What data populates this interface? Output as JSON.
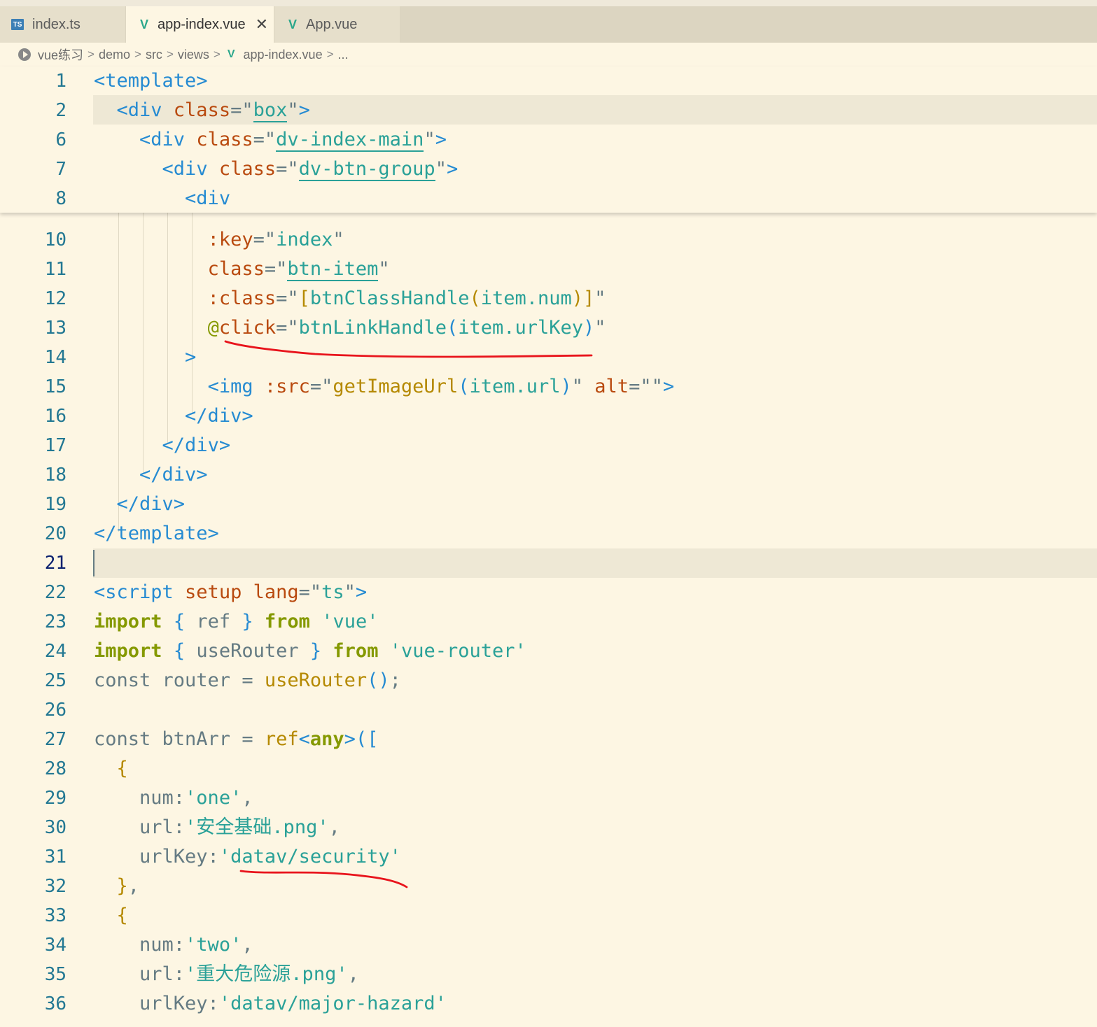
{
  "tabs": [
    {
      "label": "index.ts",
      "icon": "typescript-icon",
      "icon_text": "TS",
      "active": false
    },
    {
      "label": "app-index.vue",
      "icon": "vue-icon",
      "active": true,
      "close": "✕"
    },
    {
      "label": "App.vue",
      "icon": "vue-icon",
      "active": false
    }
  ],
  "breadcrumb": {
    "items": [
      "vue练习",
      "demo",
      "src",
      "views",
      "app-index.vue",
      "..."
    ],
    "separator": ">",
    "vue_glyph": "V"
  },
  "editor": {
    "current_line": "21",
    "sticky_lines": [
      {
        "num": "1",
        "tokens": [
          [
            "t-tag",
            "<template>"
          ]
        ]
      },
      {
        "num": "2",
        "tokens": [
          [
            "t-punc",
            "  "
          ],
          [
            "t-tag",
            "<div "
          ],
          [
            "t-attr",
            "class"
          ],
          [
            "t-punc",
            "=\""
          ],
          [
            "t-cls",
            "box"
          ],
          [
            "t-punc",
            "\""
          ],
          [
            "t-tag",
            ">"
          ]
        ]
      },
      {
        "num": "6",
        "tokens": [
          [
            "t-punc",
            "    "
          ],
          [
            "t-tag",
            "<div "
          ],
          [
            "t-attr",
            "class"
          ],
          [
            "t-punc",
            "=\""
          ],
          [
            "t-cls",
            "dv-index-main"
          ],
          [
            "t-punc",
            "\""
          ],
          [
            "t-tag",
            ">"
          ]
        ]
      },
      {
        "num": "7",
        "tokens": [
          [
            "t-punc",
            "      "
          ],
          [
            "t-tag",
            "<div "
          ],
          [
            "t-attr",
            "class"
          ],
          [
            "t-punc",
            "=\""
          ],
          [
            "t-cls",
            "dv-btn-group"
          ],
          [
            "t-punc",
            "\""
          ],
          [
            "t-tag",
            ">"
          ]
        ]
      },
      {
        "num": "8",
        "tokens": [
          [
            "t-punc",
            "        "
          ],
          [
            "t-tag",
            "<div"
          ]
        ]
      }
    ],
    "lines": [
      {
        "num": "10",
        "tokens": [
          [
            "t-punc",
            "          "
          ],
          [
            "t-attr",
            ":key"
          ],
          [
            "t-punc",
            "=\""
          ],
          [
            "t-str",
            "index"
          ],
          [
            "t-punc",
            "\""
          ]
        ]
      },
      {
        "num": "11",
        "tokens": [
          [
            "t-punc",
            "          "
          ],
          [
            "t-attr",
            "class"
          ],
          [
            "t-punc",
            "=\""
          ],
          [
            "t-cls",
            "btn-item"
          ],
          [
            "t-punc",
            "\""
          ]
        ]
      },
      {
        "num": "12",
        "tokens": [
          [
            "t-punc",
            "          "
          ],
          [
            "t-attr",
            ":class"
          ],
          [
            "t-punc",
            "=\""
          ],
          [
            "t-fn",
            "["
          ],
          [
            "t-str",
            "btnClassHandle"
          ],
          [
            "t-fn",
            "("
          ],
          [
            "t-str",
            "item.num"
          ],
          [
            "t-fn",
            ")]"
          ],
          [
            "t-punc",
            "\""
          ]
        ]
      },
      {
        "num": "13",
        "tokens": [
          [
            "t-punc",
            "          "
          ],
          [
            "t-at",
            "@"
          ],
          [
            "t-attr",
            "click"
          ],
          [
            "t-punc",
            "=\""
          ],
          [
            "t-str",
            "btnLinkHandle"
          ],
          [
            "t-bkt",
            "("
          ],
          [
            "t-str",
            "item.urlKey"
          ],
          [
            "t-bkt",
            ")"
          ],
          [
            "t-punc",
            "\""
          ]
        ]
      },
      {
        "num": "14",
        "tokens": [
          [
            "t-punc",
            "        "
          ],
          [
            "t-tag",
            ">"
          ]
        ]
      },
      {
        "num": "15",
        "tokens": [
          [
            "t-punc",
            "          "
          ],
          [
            "t-tag",
            "<img "
          ],
          [
            "t-attr",
            ":src"
          ],
          [
            "t-punc",
            "=\""
          ],
          [
            "t-fn",
            "getImageUrl"
          ],
          [
            "t-bkt",
            "("
          ],
          [
            "t-str",
            "item.url"
          ],
          [
            "t-bkt",
            ")"
          ],
          [
            "t-punc",
            "\" "
          ],
          [
            "t-attr",
            "alt"
          ],
          [
            "t-punc",
            "=\"\""
          ],
          [
            "t-tag",
            ">"
          ]
        ]
      },
      {
        "num": "16",
        "tokens": [
          [
            "t-punc",
            "        "
          ],
          [
            "t-tag",
            "</div>"
          ]
        ]
      },
      {
        "num": "17",
        "tokens": [
          [
            "t-punc",
            "      "
          ],
          [
            "t-tag",
            "</div>"
          ]
        ]
      },
      {
        "num": "18",
        "tokens": [
          [
            "t-punc",
            "    "
          ],
          [
            "t-tag",
            "</div>"
          ]
        ]
      },
      {
        "num": "19",
        "tokens": [
          [
            "t-punc",
            "  "
          ],
          [
            "t-tag",
            "</div>"
          ]
        ]
      },
      {
        "num": "20",
        "tokens": [
          [
            "t-tag",
            "</template>"
          ]
        ]
      },
      {
        "num": "21",
        "tokens": []
      },
      {
        "num": "22",
        "tokens": [
          [
            "t-tag",
            "<script "
          ],
          [
            "t-attr",
            "setup "
          ],
          [
            "t-attr",
            "lang"
          ],
          [
            "t-punc",
            "=\""
          ],
          [
            "t-str",
            "ts"
          ],
          [
            "t-punc",
            "\""
          ],
          [
            "t-tag",
            ">"
          ]
        ]
      },
      {
        "num": "23",
        "tokens": [
          [
            "t-kw",
            "import"
          ],
          [
            "t-punc",
            " "
          ],
          [
            "t-bkt",
            "{"
          ],
          [
            "t-punc",
            " ref "
          ],
          [
            "t-bkt",
            "}"
          ],
          [
            "t-punc",
            " "
          ],
          [
            "t-kw",
            "from"
          ],
          [
            "t-punc",
            " "
          ],
          [
            "t-str",
            "'vue'"
          ]
        ]
      },
      {
        "num": "24",
        "tokens": [
          [
            "t-kw",
            "import"
          ],
          [
            "t-punc",
            " "
          ],
          [
            "t-bkt",
            "{"
          ],
          [
            "t-punc",
            " useRouter "
          ],
          [
            "t-bkt",
            "}"
          ],
          [
            "t-punc",
            " "
          ],
          [
            "t-kw",
            "from"
          ],
          [
            "t-punc",
            " "
          ],
          [
            "t-str",
            "'vue-router'"
          ]
        ]
      },
      {
        "num": "25",
        "tokens": [
          [
            "t-punc",
            "const router = "
          ],
          [
            "t-fn",
            "useRouter"
          ],
          [
            "t-bkt",
            "()"
          ],
          [
            "t-punc",
            ";"
          ]
        ]
      },
      {
        "num": "26",
        "tokens": []
      },
      {
        "num": "27",
        "tokens": [
          [
            "t-punc",
            "const btnArr = "
          ],
          [
            "t-fn",
            "ref"
          ],
          [
            "t-tag",
            "<"
          ],
          [
            "t-kw",
            "any"
          ],
          [
            "t-tag",
            ">"
          ],
          [
            "t-bkt",
            "(["
          ]
        ]
      },
      {
        "num": "28",
        "tokens": [
          [
            "t-punc",
            "  "
          ],
          [
            "t-fn",
            "{"
          ]
        ]
      },
      {
        "num": "29",
        "tokens": [
          [
            "t-punc",
            "    num:"
          ],
          [
            "t-str",
            "'one'"
          ],
          [
            "t-punc",
            ","
          ]
        ]
      },
      {
        "num": "30",
        "tokens": [
          [
            "t-punc",
            "    url:"
          ],
          [
            "t-str",
            "'安全基础.png'"
          ],
          [
            "t-punc",
            ","
          ]
        ]
      },
      {
        "num": "31",
        "tokens": [
          [
            "t-punc",
            "    urlKey:"
          ],
          [
            "t-str",
            "'datav/security'"
          ]
        ]
      },
      {
        "num": "32",
        "tokens": [
          [
            "t-punc",
            "  "
          ],
          [
            "t-fn",
            "}"
          ],
          [
            "t-punc",
            ","
          ]
        ]
      },
      {
        "num": "33",
        "tokens": [
          [
            "t-punc",
            "  "
          ],
          [
            "t-fn",
            "{"
          ]
        ]
      },
      {
        "num": "34",
        "tokens": [
          [
            "t-punc",
            "    num:"
          ],
          [
            "t-str",
            "'two'"
          ],
          [
            "t-punc",
            ","
          ]
        ]
      },
      {
        "num": "35",
        "tokens": [
          [
            "t-punc",
            "    url:"
          ],
          [
            "t-str",
            "'重大危险源.png'"
          ],
          [
            "t-punc",
            ","
          ]
        ]
      },
      {
        "num": "36",
        "tokens": [
          [
            "t-punc",
            "    urlKey:"
          ],
          [
            "t-str",
            "'datav/major-hazard'"
          ]
        ]
      }
    ]
  },
  "annotation_color": "#e8141c"
}
